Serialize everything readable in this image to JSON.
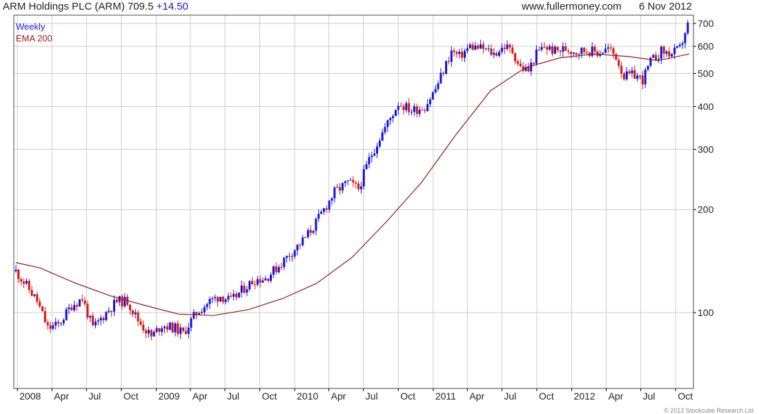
{
  "header": {
    "title": "ARM Holdings PLC (ARM) 709.5",
    "change": "+14.50",
    "site": "www.fullermoney.com",
    "date": "6 Nov 2012"
  },
  "legend": {
    "weekly": "Weekly",
    "ema": "EMA 200"
  },
  "copyright": "© 2012 Stockcube Research Ltd",
  "colors": {
    "up": "#1010dd",
    "down": "#dd1010",
    "ema": "#8b1a1a",
    "grid": "#cccccc",
    "axis": "#000000"
  },
  "chart_data": {
    "type": "candlestick",
    "frequency": "weekly",
    "x_range": [
      "2007-12-28",
      "2012-11-06"
    ],
    "y_scale": "log",
    "ylim": [
      60,
      740
    ],
    "y_ticks": [
      100,
      200,
      300,
      400,
      500,
      600,
      700
    ],
    "x_ticks": [
      {
        "label": "2008",
        "date": "2008-01-01"
      },
      {
        "label": "Apr",
        "date": "2008-04-01"
      },
      {
        "label": "Jul",
        "date": "2008-07-01"
      },
      {
        "label": "Oct",
        "date": "2008-10-01"
      },
      {
        "label": "2009",
        "date": "2009-01-01"
      },
      {
        "label": "Apr",
        "date": "2009-04-01"
      },
      {
        "label": "Jul",
        "date": "2009-07-01"
      },
      {
        "label": "Oct",
        "date": "2009-10-01"
      },
      {
        "label": "2010",
        "date": "2010-01-01"
      },
      {
        "label": "Apr",
        "date": "2010-04-01"
      },
      {
        "label": "Jul",
        "date": "2010-07-01"
      },
      {
        "label": "Oct",
        "date": "2010-10-01"
      },
      {
        "label": "2011",
        "date": "2011-01-01"
      },
      {
        "label": "Apr",
        "date": "2011-04-01"
      },
      {
        "label": "Jul",
        "date": "2011-07-01"
      },
      {
        "label": "Oct",
        "date": "2011-10-01"
      },
      {
        "label": "2012",
        "date": "2012-01-01"
      },
      {
        "label": "Apr",
        "date": "2012-04-01"
      },
      {
        "label": "Jul",
        "date": "2012-07-01"
      },
      {
        "label": "Oct",
        "date": "2012-10-01"
      }
    ],
    "grid": true,
    "price_path": [
      [
        "2007-12-28",
        132
      ],
      [
        "2008-01-25",
        120
      ],
      [
        "2008-02-22",
        108
      ],
      [
        "2008-03-21",
        90
      ],
      [
        "2008-04-18",
        92
      ],
      [
        "2008-05-23",
        105
      ],
      [
        "2008-06-20",
        110
      ],
      [
        "2008-07-18",
        90
      ],
      [
        "2008-08-22",
        100
      ],
      [
        "2008-09-19",
        108
      ],
      [
        "2008-10-17",
        108
      ],
      [
        "2008-11-14",
        95
      ],
      [
        "2008-12-19",
        85
      ],
      [
        "2009-01-16",
        92
      ],
      [
        "2009-02-20",
        90
      ],
      [
        "2009-03-13",
        87
      ],
      [
        "2009-04-17",
        100
      ],
      [
        "2009-05-22",
        108
      ],
      [
        "2009-06-19",
        112
      ],
      [
        "2009-07-17",
        108
      ],
      [
        "2009-08-21",
        118
      ],
      [
        "2009-09-18",
        125
      ],
      [
        "2009-10-16",
        126
      ],
      [
        "2009-11-20",
        137
      ],
      [
        "2009-12-18",
        148
      ],
      [
        "2010-01-22",
        162
      ],
      [
        "2010-02-19",
        178
      ],
      [
        "2010-03-19",
        200
      ],
      [
        "2010-04-16",
        225
      ],
      [
        "2010-05-21",
        240
      ],
      [
        "2010-06-18",
        230
      ],
      [
        "2010-07-16",
        280
      ],
      [
        "2010-08-13",
        325
      ],
      [
        "2010-09-10",
        370
      ],
      [
        "2010-10-01",
        410
      ],
      [
        "2010-11-05",
        390
      ],
      [
        "2010-12-10",
        400
      ],
      [
        "2011-01-07",
        450
      ],
      [
        "2011-01-28",
        510
      ],
      [
        "2011-02-18",
        580
      ],
      [
        "2011-03-11",
        560
      ],
      [
        "2011-04-08",
        600
      ],
      [
        "2011-05-13",
        590
      ],
      [
        "2011-06-10",
        570
      ],
      [
        "2011-07-08",
        600
      ],
      [
        "2011-07-29",
        580
      ],
      [
        "2011-08-19",
        520
      ],
      [
        "2011-09-09",
        510
      ],
      [
        "2011-09-30",
        570
      ],
      [
        "2011-10-21",
        600
      ],
      [
        "2011-11-18",
        580
      ],
      [
        "2011-12-16",
        590
      ],
      [
        "2012-01-13",
        580
      ],
      [
        "2012-02-10",
        585
      ],
      [
        "2012-03-09",
        575
      ],
      [
        "2012-04-06",
        590
      ],
      [
        "2012-04-27",
        560
      ],
      [
        "2012-05-18",
        490
      ],
      [
        "2012-06-15",
        495
      ],
      [
        "2012-07-06",
        480
      ],
      [
        "2012-07-27",
        540
      ],
      [
        "2012-08-24",
        580
      ],
      [
        "2012-09-21",
        570
      ],
      [
        "2012-10-12",
        590
      ],
      [
        "2012-10-26",
        660
      ],
      [
        "2012-11-06",
        709.5
      ]
    ],
    "ema_200": [
      [
        "2007-12-28",
        140
      ],
      [
        "2008-03-01",
        135
      ],
      [
        "2008-06-01",
        122
      ],
      [
        "2008-09-01",
        112
      ],
      [
        "2008-12-01",
        105
      ],
      [
        "2009-03-01",
        99
      ],
      [
        "2009-06-01",
        98
      ],
      [
        "2009-09-01",
        102
      ],
      [
        "2009-12-01",
        110
      ],
      [
        "2010-03-01",
        122
      ],
      [
        "2010-06-01",
        145
      ],
      [
        "2010-09-01",
        185
      ],
      [
        "2010-12-01",
        240
      ],
      [
        "2011-03-01",
        330
      ],
      [
        "2011-06-01",
        445
      ],
      [
        "2011-09-01",
        520
      ],
      [
        "2011-12-01",
        555
      ],
      [
        "2012-03-01",
        570
      ],
      [
        "2012-06-01",
        560
      ],
      [
        "2012-08-15",
        545
      ],
      [
        "2012-11-06",
        570
      ]
    ]
  }
}
